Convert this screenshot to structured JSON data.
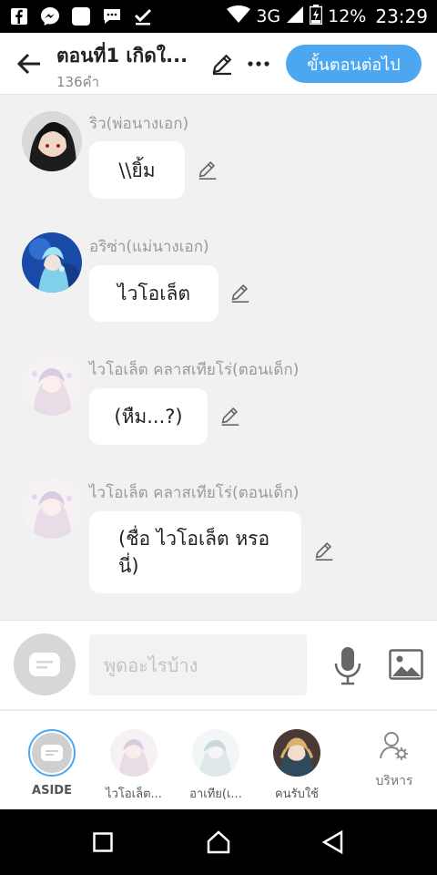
{
  "status_bar": {
    "network": "3G",
    "battery": "12%",
    "time": "23:29",
    "icons": [
      "facebook-icon",
      "messenger-icon",
      "app-icon",
      "chat-icon",
      "check-icon",
      "wifi-icon",
      "signal-icon",
      "battery-icon"
    ]
  },
  "header": {
    "title": "ตอนที่1 เกิดใ...",
    "word_count": "136คำ",
    "next_button": "ขั้นตอนต่อไป"
  },
  "messages": [
    {
      "sender": "ริว(พ่อนางเอก)",
      "text": "\\\\ยิ้ม"
    },
    {
      "sender": "อริซ่า(แม่นางเอก)",
      "text": "ไวโอเล็ต"
    },
    {
      "sender": "ไวโอเล็ต คลาสเทียโร่(ตอนเด็ก)",
      "text": "(หืม...?)"
    },
    {
      "sender": "ไวโอเล็ต คลาสเทียโร่(ตอนเด็ก)",
      "text": "(ชื่อ ไวโอเล็ต หรอ นี่)"
    }
  ],
  "composer": {
    "placeholder": "พูดอะไรบ้าง"
  },
  "characters": {
    "aside": "ASIDE",
    "c1": "ไวโอเล็ต...",
    "c2": "อาเทีย(เ...",
    "c3": "คนรับใช้",
    "manage": "บริหาร"
  },
  "colors": {
    "accent": "#4da7f0",
    "background": "#f1f1f1",
    "bubble": "#ffffff"
  }
}
